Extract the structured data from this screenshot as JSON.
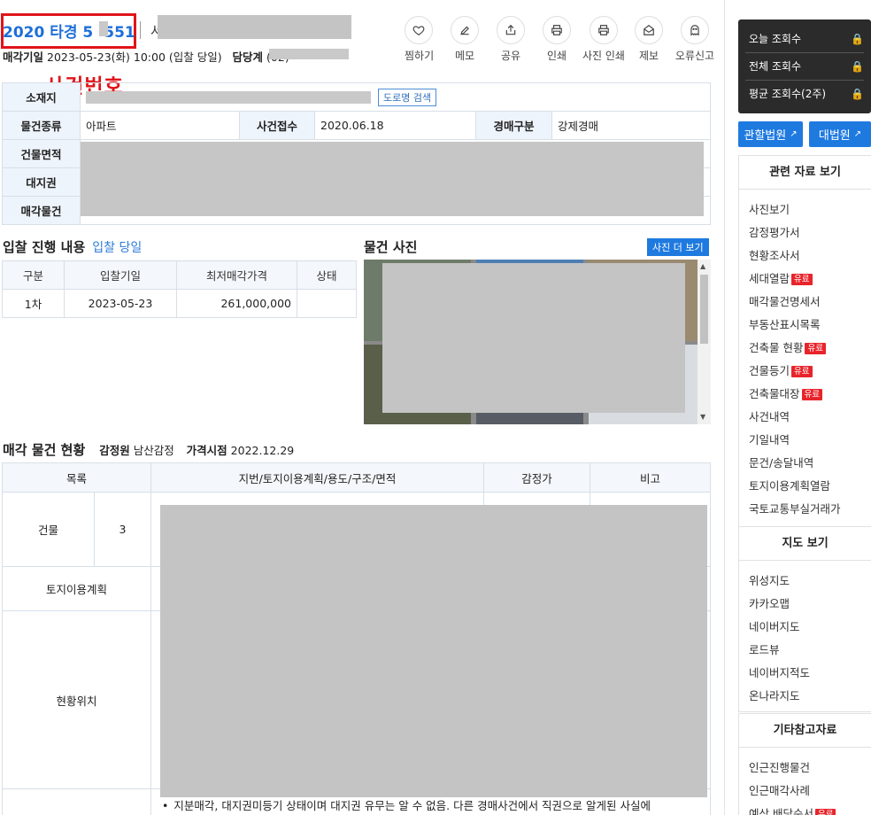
{
  "header": {
    "case_number": "2020 타경 5",
    "case_number_tail": "551",
    "title_visible_char": "서",
    "sale_date_label": "매각기일",
    "sale_date_value": "2023-05-23(화) 10:00 (입찰 당일)",
    "dept_label": "담당계",
    "dept_value": "(02)",
    "annotation": "사건번호"
  },
  "toolbar": {
    "items": [
      {
        "label": "찜하기",
        "icon": "heart-icon"
      },
      {
        "label": "메모",
        "icon": "memo-icon"
      },
      {
        "label": "공유",
        "icon": "share-icon"
      },
      {
        "label": "인쇄",
        "icon": "print-icon"
      },
      {
        "label": "사진 인쇄",
        "icon": "photo-print-icon"
      },
      {
        "label": "제보",
        "icon": "report-mail-icon"
      },
      {
        "label": "오류신고",
        "icon": "ghost-icon"
      }
    ]
  },
  "info": {
    "address_label": "소재지",
    "road_search": "도로명 검색",
    "type_label": "물건종류",
    "type_value": "아파트",
    "received_label": "사건접수",
    "received_value": "2020.06.18",
    "auction_kind_label": "경매구분",
    "auction_kind_value": "강제경매",
    "building_area_label": "건물면적",
    "land_right_label": "대지권",
    "sale_items_label": "매각물건"
  },
  "bid": {
    "title": "입찰 진행 내용",
    "status_link": "입찰 당일",
    "headers": [
      "구분",
      "입찰기일",
      "최저매각가격",
      "상태"
    ],
    "rows": [
      {
        "round": "1차",
        "date": "2023-05-23",
        "price": "261,000,000",
        "status": ""
      }
    ]
  },
  "photos": {
    "title": "물건 사진",
    "more": "사진 더 보기"
  },
  "sale": {
    "title": "매각 물건 현황",
    "appraiser_label": "감정원",
    "appraiser_value": "남산감정",
    "price_date_label": "가격시점",
    "price_date_value": "2022.12.29",
    "headers": [
      "목록",
      "지번/토지이용계획/용도/구조/면적",
      "감정가",
      "비고"
    ],
    "building_label": "건물",
    "building_count": "3",
    "land_plan_label": "토지이용계획",
    "location_label": "현황위치",
    "note": "지분매각, 대지권미등기 상태이며 대지권 유무는 알 수 없음. 다른 경매사건에서 직권으로 알게된 사실에"
  },
  "sidebar": {
    "stats": [
      {
        "label": "오늘 조회수"
      },
      {
        "label": "전체 조회수"
      },
      {
        "label": "평균 조회수(2주)"
      }
    ],
    "court_buttons": [
      "관할법원",
      "대법원"
    ],
    "related_title": "관련 자료 보기",
    "related_links": [
      {
        "label": "사진보기",
        "paid": false
      },
      {
        "label": "감정평가서",
        "paid": false
      },
      {
        "label": "현황조사서",
        "paid": false
      },
      {
        "label": "세대열람",
        "paid": true
      },
      {
        "label": "매각물건명세서",
        "paid": false
      },
      {
        "label": "부동산표시목록",
        "paid": false
      },
      {
        "label": "건축물 현황",
        "paid": true
      },
      {
        "label": "건물등기",
        "paid": true
      },
      {
        "label": "건축물대장",
        "paid": true
      },
      {
        "label": "사건내역",
        "paid": false
      },
      {
        "label": "기일내역",
        "paid": false
      },
      {
        "label": "문건/송달내역",
        "paid": false
      },
      {
        "label": "토지이용계획열람",
        "paid": false
      },
      {
        "label": "국토교통부실거래가",
        "paid": false
      }
    ],
    "map_title": "지도 보기",
    "map_links": [
      "위성지도",
      "카카오맵",
      "네이버지도",
      "로드뷰",
      "네이버지적도",
      "온나라지도"
    ],
    "etc_title": "기타참고자료",
    "etc_links": [
      "인근진행물건",
      "인근매각사례",
      "예상 배당순서"
    ],
    "paid_badge": "유료"
  }
}
